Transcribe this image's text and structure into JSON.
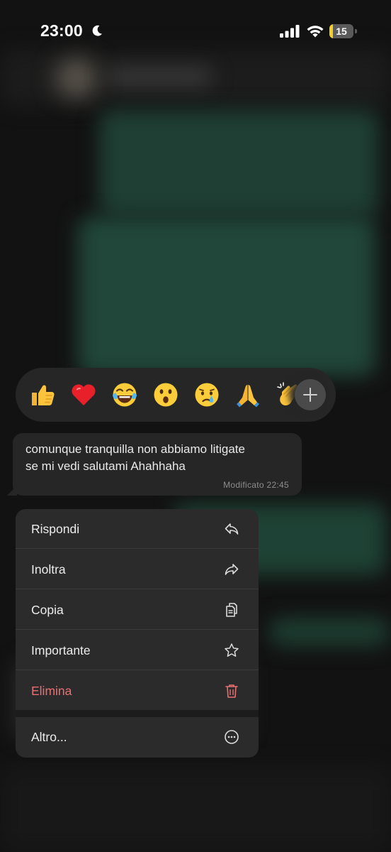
{
  "status_bar": {
    "time": "23:00",
    "battery_level": "15",
    "icons": [
      "moon-icon",
      "signal-icon",
      "wifi-icon",
      "battery-icon"
    ]
  },
  "reactions": {
    "emojis": [
      "👍",
      "❤️",
      "😂",
      "😮",
      "😢",
      "🙏",
      "👏"
    ],
    "more_icon": "plus-icon"
  },
  "message": {
    "text_line1": "comunque tranquilla non abbiamo litigate",
    "text_line2": "se mi vedi salutami Ahahhaha",
    "meta": "Modificato 22:45"
  },
  "menu": {
    "items": [
      {
        "label": "Rispondi",
        "icon": "reply-icon"
      },
      {
        "label": "Inoltra",
        "icon": "forward-icon"
      },
      {
        "label": "Copia",
        "icon": "copy-icon"
      },
      {
        "label": "Importante",
        "icon": "star-icon"
      },
      {
        "label": "Elimina",
        "icon": "trash-icon",
        "color": "#ea6f72"
      }
    ],
    "more": {
      "label": "Altro...",
      "icon": "more-icon"
    }
  },
  "colors": {
    "background": "#121212",
    "surface": "#262626",
    "menu": "#2b2b2b",
    "danger": "#ea6f72",
    "battery_low": "#f5cf29"
  }
}
